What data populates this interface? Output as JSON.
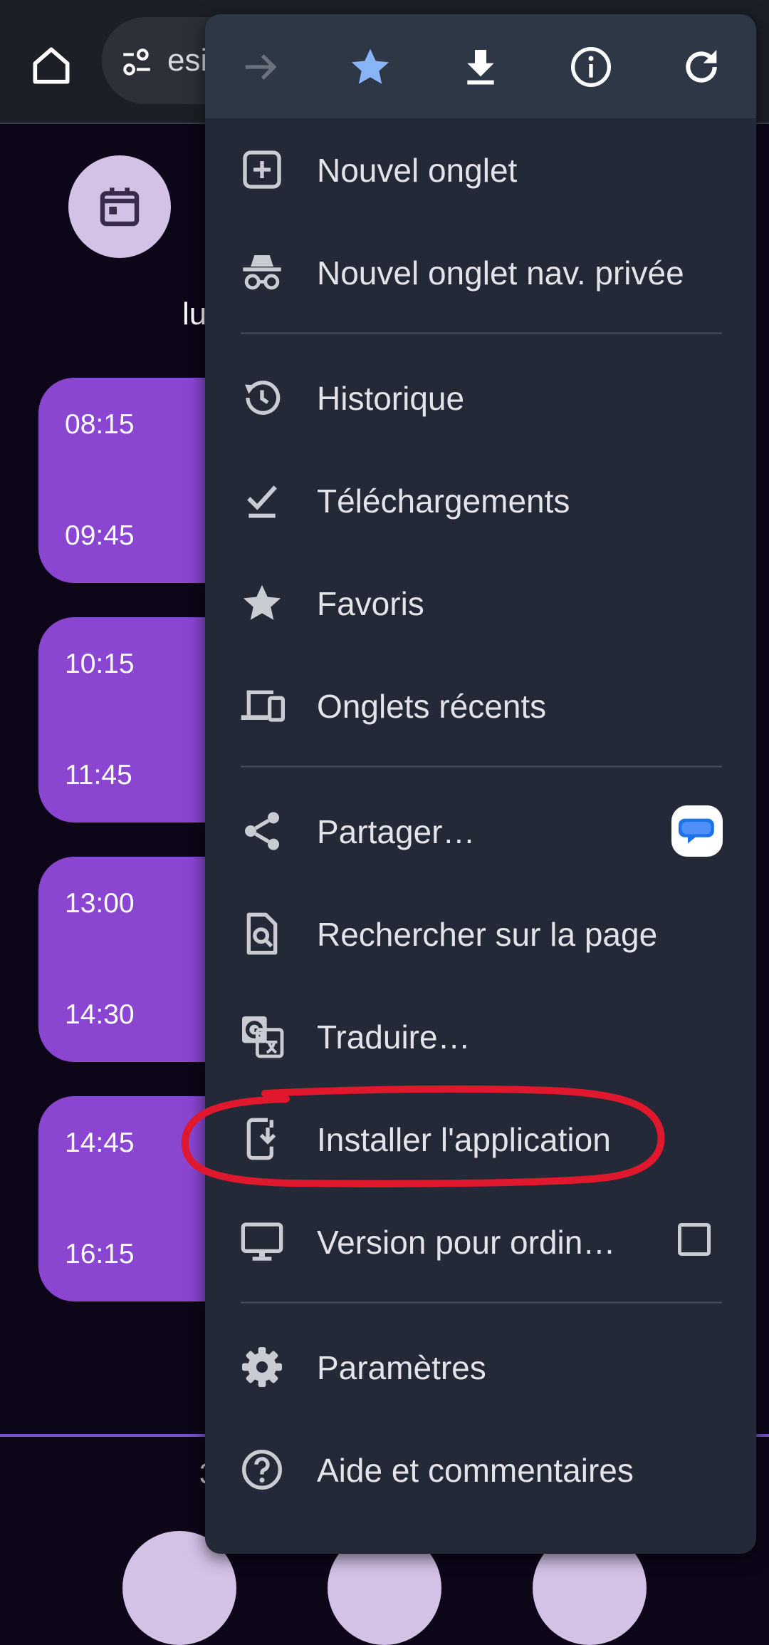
{
  "browser": {
    "url_fragment": "esi"
  },
  "page": {
    "day_label": "lu",
    "slots": [
      {
        "start": "08:15",
        "end": "09:45"
      },
      {
        "start": "10:15",
        "end": "11:45"
      },
      {
        "start": "13:00",
        "end": "14:30"
      },
      {
        "start": "14:45",
        "end": "16:15"
      }
    ],
    "bottom_partial_text": "3"
  },
  "menu": {
    "actions": [
      {
        "name": "forward-icon",
        "enabled": false
      },
      {
        "name": "bookmark-star-icon",
        "active": true
      },
      {
        "name": "download-icon"
      },
      {
        "name": "info-icon"
      },
      {
        "name": "reload-icon"
      }
    ],
    "items": [
      {
        "label": "Nouvel onglet",
        "icon": "new-tab-icon"
      },
      {
        "label": "Nouvel onglet nav. privée",
        "icon": "incognito-icon"
      },
      {
        "label": "Historique",
        "icon": "history-icon"
      },
      {
        "label": "Téléchargements",
        "icon": "downloads-check-icon"
      },
      {
        "label": "Favoris",
        "icon": "star-icon"
      },
      {
        "label": "Onglets récents",
        "icon": "devices-icon"
      },
      {
        "label": "Partager…",
        "icon": "share-icon"
      },
      {
        "label": "Rechercher sur la page",
        "icon": "find-in-page-icon"
      },
      {
        "label": "Traduire…",
        "icon": "translate-icon"
      },
      {
        "label": "Installer l'application",
        "icon": "install-app-icon"
      },
      {
        "label": "Version pour ordin…",
        "icon": "desktop-icon"
      },
      {
        "label": "Paramètres",
        "icon": "settings-gear-icon"
      },
      {
        "label": "Aide et commentaires",
        "icon": "help-icon"
      }
    ]
  },
  "colors": {
    "menu_bg": "#232936",
    "action_bar_bg": "#2e3746",
    "slot_purple": "#8a46d1",
    "star_blue": "#8ab4f8",
    "annotation_red": "#e0182d"
  }
}
